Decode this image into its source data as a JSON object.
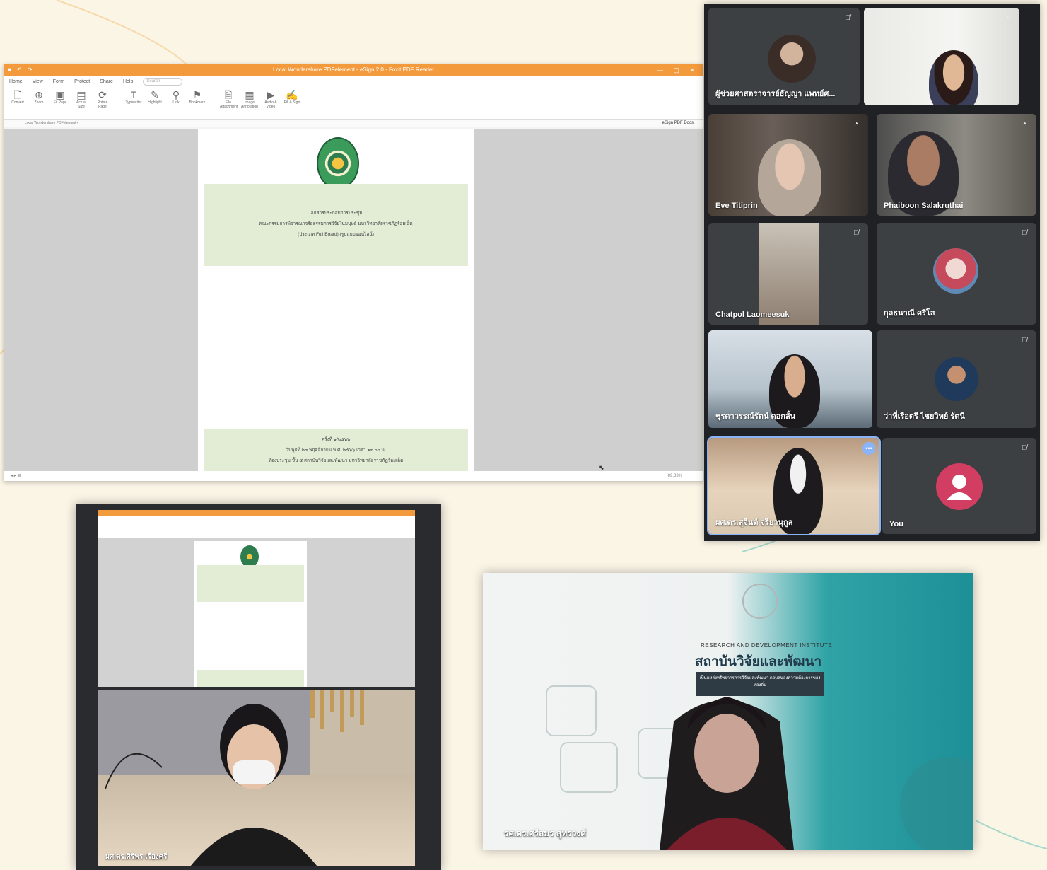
{
  "pdf_editor": {
    "title": "Local Wondershare PDFelement - eSign 2.0 - Foxit PDF Reader",
    "menu": [
      "Home",
      "View",
      "Form",
      "Protect",
      "Share",
      "Help"
    ],
    "search_placeholder": "Search",
    "ribbon": [
      "Convert",
      "Zoom",
      "Fit Page",
      "Actual Size",
      "Rotate Page",
      "Typewriter",
      "Highlight",
      "Link",
      "Bookmark",
      "File Attachment",
      "Image Annotation",
      "Audio & Video",
      "Fill & Sign"
    ],
    "esign_label": "eSign PDF Docs",
    "document": {
      "heading": "เอกสารประกอบการประชุม",
      "line2": "คณะกรรมการพิจารณาจริยธรรมการวิจัยในมนุษย์ มหาวิทยาลัยราชภัฏร้อยเอ็ด",
      "line3": "(ประเภท Full Board) (รูปแบบออนไลน์)",
      "footer1": "ครั้งที่ ๑/๒๕๖๖",
      "footer2": "วันพุธที่ ๒๓ พฤศจิกายน พ.ศ. ๒๕๖๖ เวลา ๑๓.๐๐ น.",
      "footer3": "ห้องประชุม ชั้น ๕ สถาบันวิจัยและพัฒนา มหาวิทยาลัยราชภัฏร้อยเอ็ด"
    },
    "zoom": "89.33%"
  },
  "meeting": {
    "participants": [
      {
        "name": "ผู้ช่วยศาสตราจารย์ธัญญา แพทย์ศ...",
        "muted": true
      },
      {
        "name": "",
        "muted": false
      },
      {
        "name": "Eve Titiprin",
        "muted": false
      },
      {
        "name": "Phaiboon Salakruthai",
        "muted": false
      },
      {
        "name": "Chatpol Laomeesuk",
        "muted": true
      },
      {
        "name": "กุลธนาณี ศรีโส",
        "muted": true
      },
      {
        "name": "ชุรดาวรรณ์รัตน์ ดอกลั้น",
        "muted": false
      },
      {
        "name": "ว่าที่เรือตรี ไชยวิทย์ รัตนี",
        "muted": true
      },
      {
        "name": "ผศ.ดร.สุจินต์ จริยานุกูล",
        "muted": false
      },
      {
        "name": "You",
        "muted": true
      }
    ]
  },
  "video_left": {
    "name": "ผศ.ดร.ศิริพร เรืองศรี"
  },
  "video_right": {
    "institute_en": "RESEARCH AND DEVELOPMENT INSTITUTE",
    "institute_th": "สถาบันวิจัยและพัฒนา",
    "tagline": "เป็นแหล่งทรัพยากรการวิจัยและพัฒนา ตอบสนองความต้องการของท้องถิ่น",
    "name": "รศ.ดร.ศรีสมร สุทรวงศ์"
  }
}
